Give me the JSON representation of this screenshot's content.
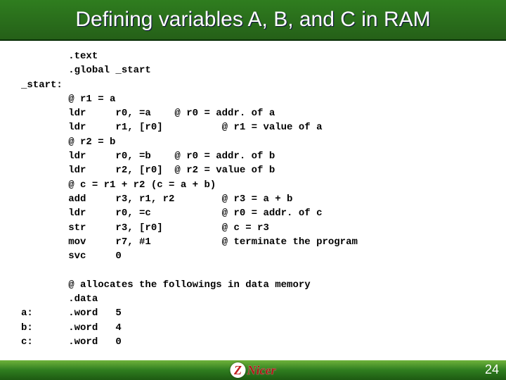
{
  "slide": {
    "title": "Defining variables A, B, and C in RAM",
    "page_number": "24",
    "logo": {
      "mark": "Z",
      "text": "Nicer"
    }
  },
  "code": {
    "lines": [
      "        .text",
      "        .global _start",
      "_start:",
      "        @ r1 = a",
      "        ldr     r0, =a    @ r0 = addr. of a",
      "        ldr     r1, [r0]          @ r1 = value of a",
      "        @ r2 = b",
      "        ldr     r0, =b    @ r0 = addr. of b",
      "        ldr     r2, [r0]  @ r2 = value of b",
      "        @ c = r1 + r2 (c = a + b)",
      "        add     r3, r1, r2        @ r3 = a + b",
      "        ldr     r0, =c            @ r0 = addr. of c",
      "        str     r3, [r0]          @ c = r3",
      "        mov     r7, #1            @ terminate the program",
      "        svc     0",
      "",
      "        @ allocates the followings in data memory",
      "        .data",
      "a:      .word   5",
      "b:      .word   4",
      "c:      .word   0"
    ]
  }
}
